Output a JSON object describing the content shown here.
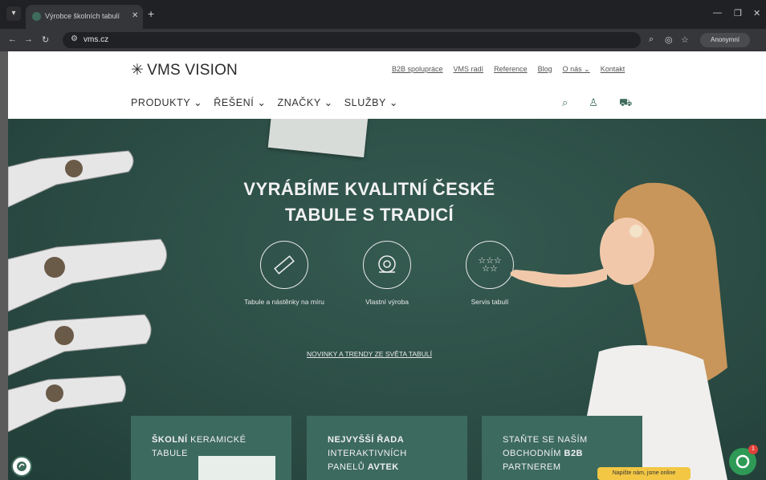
{
  "browser": {
    "tab_title": "Výrobce školních tabulí | VMS",
    "url": "vms.cz",
    "profile_label": "Anonymní"
  },
  "site": {
    "logo_text": "VMS VISION",
    "util_links": [
      "B2B spolupráce",
      "VMS radí",
      "Reference",
      "Blog",
      "O nás",
      "Kontakt"
    ],
    "main_menu": [
      "PRODUKTY",
      "ŘEŠENÍ",
      "ZNAČKY",
      "SLUŽBY"
    ]
  },
  "hero": {
    "title_line1": "VYRÁBÍME KVALITNÍ ČESKÉ",
    "title_line2": "TABULE S TRADICÍ",
    "features": [
      {
        "label": "Tabule a nástěnky na míru",
        "icon": "ruler-icon"
      },
      {
        "label": "Vlastní výroba",
        "icon": "saw-blade-icon"
      },
      {
        "label": "Servis tabulí",
        "icon": "stars-icon"
      }
    ],
    "news_link": "NOVINKY A TRENDY ZE SVĚTA TABULÍ"
  },
  "cards": [
    {
      "bold": "ŠKOLNÍ",
      "rest1": " KERAMICKÉ",
      "line2": "TABULE"
    },
    {
      "bold": "NEJVYŠŠÍ ŘADA",
      "line2": "INTERAKTIVNÍCH",
      "line3a": "PANELŮ ",
      "line3b": "AVTEK"
    },
    {
      "line1": "STAŇTE SE NAŠÍM",
      "line2a": "OBCHODNÍM ",
      "line2b": "B2B",
      "line3": "PARTNEREM"
    }
  ],
  "chat": {
    "bubble_text": "Napište nám, jsme online",
    "badge_count": "1"
  },
  "colors": {
    "brand_green": "#3e6b5c",
    "board_green": "#2b4c44",
    "chat_green": "#2e9a56",
    "chat_yellow": "#f3c744"
  }
}
